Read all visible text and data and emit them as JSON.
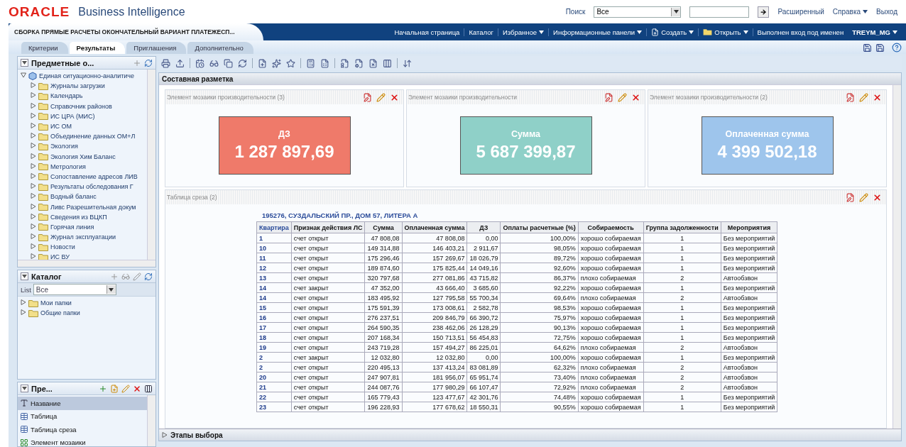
{
  "header": {
    "logo": "ORACLE",
    "product": "Business Intelligence",
    "search_label": "Поиск",
    "search_scope": "Все",
    "links": [
      {
        "label": "Расширенный",
        "dropdown": false
      },
      {
        "label": "Справка",
        "dropdown": true
      },
      {
        "label": "Выход",
        "dropdown": false
      }
    ]
  },
  "document_title": "СБОРКА ПРЯМЫЕ РАСЧЕТЫ ОКОНЧАТЕЛЬНЫЙ ВАРИАНТ ПЛАТЕЖЕСП...",
  "nav": [
    {
      "label": "Начальная страница",
      "dropdown": false,
      "kind": "link"
    },
    {
      "label": "Каталог",
      "dropdown": false,
      "kind": "link"
    },
    {
      "label": "Избранное",
      "dropdown": true,
      "kind": "link"
    },
    {
      "label": "Информационные панели",
      "dropdown": true,
      "kind": "link"
    },
    {
      "label": "Создать",
      "dropdown": true,
      "kind": "new"
    },
    {
      "label": "Открыть",
      "dropdown": true,
      "kind": "folder"
    },
    {
      "label": "Выполнен вход под именен",
      "dropdown": false,
      "kind": "text"
    }
  ],
  "user": {
    "name": "TREYM_MG",
    "dropdown": true
  },
  "tabs": [
    {
      "label": "Критерии",
      "selected": false
    },
    {
      "label": "Результаты",
      "selected": true
    },
    {
      "label": "Приглашения",
      "selected": false
    },
    {
      "label": "Дополнительно",
      "selected": false
    }
  ],
  "subject_areas": {
    "title": "Предметные о...",
    "tree": [
      {
        "label": "Единая ситуационно-аналитиче",
        "expanded": true,
        "children": [
          {
            "label": "Журналы загрузки",
            "expanded": false
          },
          {
            "label": "Календарь",
            "expanded": false
          },
          {
            "label": "Справочник районов",
            "expanded": false
          },
          {
            "label": "ИС ЦРА (МИС)",
            "expanded": false
          },
          {
            "label": "ИС ОМ",
            "expanded": false
          },
          {
            "label": "Объединение данных ОМ+Л",
            "expanded": false
          },
          {
            "label": "Экология",
            "expanded": false
          },
          {
            "label": "Экология Хим Баланс",
            "expanded": false
          },
          {
            "label": "Метрология",
            "expanded": false
          },
          {
            "label": "Сопоставление адресов ЛИВ",
            "expanded": false
          },
          {
            "label": "Результаты обследования Г",
            "expanded": false
          },
          {
            "label": "Водный баланс",
            "expanded": false
          },
          {
            "label": "Ливс Разрешительная докум",
            "expanded": false
          },
          {
            "label": "Сведения из ВЦКП",
            "expanded": false
          },
          {
            "label": "Горячая линия",
            "expanded": false
          },
          {
            "label": "Журнал эксплуатации",
            "expanded": false
          },
          {
            "label": "Новости",
            "expanded": false
          },
          {
            "label": "ИС ВУ",
            "expanded": false
          }
        ]
      }
    ]
  },
  "catalog": {
    "title": "Каталог",
    "list_label": "List",
    "list_value": "Все",
    "items": [
      {
        "label": "Мои папки",
        "expanded": false
      },
      {
        "label": "Общие папки",
        "expanded": false
      }
    ]
  },
  "presentations": {
    "title": "Пре...",
    "items": [
      {
        "label": "Название",
        "kind": "title",
        "selected": true
      },
      {
        "label": "Таблица",
        "kind": "table",
        "selected": false
      },
      {
        "label": "Таблица среза",
        "kind": "table",
        "selected": false
      },
      {
        "label": "Элемент мозаики",
        "kind": "tile",
        "selected": false
      }
    ]
  },
  "layout": {
    "title": "Составная разметка",
    "tiles": [
      {
        "title": "Элемент мозаики производительности (3)",
        "label": "ДЗ",
        "value": "1 287 897,69",
        "color": "#ef7a6a"
      },
      {
        "title": "Элемент мозаики производительности",
        "label": "Сумма",
        "value": "5 687 399,87",
        "color": "#8fd0c8"
      },
      {
        "title": "Элемент мозаики производительности (2)",
        "label": "Оплаченная сумма",
        "value": "4 399 502,18",
        "color": "#9ec5ec"
      }
    ],
    "table_view": {
      "title": "Таблица среза (2)",
      "caption": "195276, СУЗДАЛЬСКИЙ ПР., ДОМ 57, ЛИТЕРА А",
      "columns": [
        "Квартира",
        "Признак действия ЛС",
        "Сумма",
        "Оплаченная сумма",
        "ДЗ",
        "Оплаты расчетные (%)",
        "Собираемость",
        "Группа задолженности",
        "Мероприятия"
      ],
      "rows": [
        [
          "1",
          "счет открыт",
          "47 808,08",
          "47 808,08",
          "0,00",
          "100,00%",
          "хорошо собираемая",
          "1",
          "Без мероприятий"
        ],
        [
          "10",
          "счет открыт",
          "149 314,88",
          "146 403,21",
          "2 911,67",
          "98,05%",
          "хорошо собираемая",
          "1",
          "Без мероприятий"
        ],
        [
          "11",
          "счет открыт",
          "175 296,46",
          "157 269,67",
          "18 026,79",
          "89,72%",
          "хорошо собираемая",
          "1",
          "Без мероприятий"
        ],
        [
          "12",
          "счет открыт",
          "189 874,60",
          "175 825,44",
          "14 049,16",
          "92,60%",
          "хорошо собираемая",
          "1",
          "Без мероприятий"
        ],
        [
          "13",
          "счет открыт",
          "320 797,68",
          "277 081,86",
          "43 715,82",
          "86,37%",
          "плохо собираемая",
          "2",
          "Автообзвон"
        ],
        [
          "14",
          "счет закрыт",
          "47 352,00",
          "43 666,40",
          "3 685,60",
          "92,22%",
          "хорошо собираемая",
          "1",
          "Без мероприятий"
        ],
        [
          "14",
          "счет открыт",
          "183 495,92",
          "127 795,58",
          "55 700,34",
          "69,64%",
          "плохо собираемая",
          "2",
          "Автообзвон"
        ],
        [
          "15",
          "счет открыт",
          "175 591,39",
          "173 008,61",
          "2 582,78",
          "98,53%",
          "хорошо собираемая",
          "1",
          "Без мероприятий"
        ],
        [
          "16",
          "счет открыт",
          "276 237,51",
          "209 846,79",
          "66 390,72",
          "75,97%",
          "хорошо собираемая",
          "1",
          "Без мероприятий"
        ],
        [
          "17",
          "счет открыт",
          "264 590,35",
          "238 462,06",
          "26 128,29",
          "90,13%",
          "хорошо собираемая",
          "1",
          "Без мероприятий"
        ],
        [
          "18",
          "счет открыт",
          "207 168,34",
          "150 713,51",
          "56 454,83",
          "72,75%",
          "хорошо собираемая",
          "1",
          "Без мероприятий"
        ],
        [
          "19",
          "счет открыт",
          "243 719,28",
          "157 494,27",
          "86 225,01",
          "64,62%",
          "плохо собираемая",
          "2",
          "Автообзвон"
        ],
        [
          "2",
          "счет закрыт",
          "12 032,80",
          "12 032,80",
          "0,00",
          "100,00%",
          "хорошо собираемая",
          "1",
          "Без мероприятий"
        ],
        [
          "2",
          "счет открыт",
          "220 495,13",
          "137 413,24",
          "83 081,89",
          "62,32%",
          "плохо собираемая",
          "2",
          "Автообзвон"
        ],
        [
          "20",
          "счет открыт",
          "247 907,81",
          "181 956,07",
          "65 951,74",
          "73,40%",
          "плохо собираемая",
          "2",
          "Автообзвон"
        ],
        [
          "21",
          "счет открыт",
          "244 087,76",
          "177 980,29",
          "66 107,47",
          "72,92%",
          "плохо собираемая",
          "2",
          "Автообзвон"
        ],
        [
          "22",
          "счет открыт",
          "165 779,43",
          "123 477,67",
          "42 301,76",
          "74,48%",
          "хорошо собираемая",
          "1",
          "Без мероприятий"
        ],
        [
          "23",
          "счет открыт",
          "196 228,93",
          "177 678,62",
          "18 550,31",
          "90,55%",
          "хорошо собираемая",
          "1",
          "Без мероприятий"
        ]
      ]
    }
  },
  "footer": {
    "title": "Этапы выбора",
    "expanded": false
  }
}
